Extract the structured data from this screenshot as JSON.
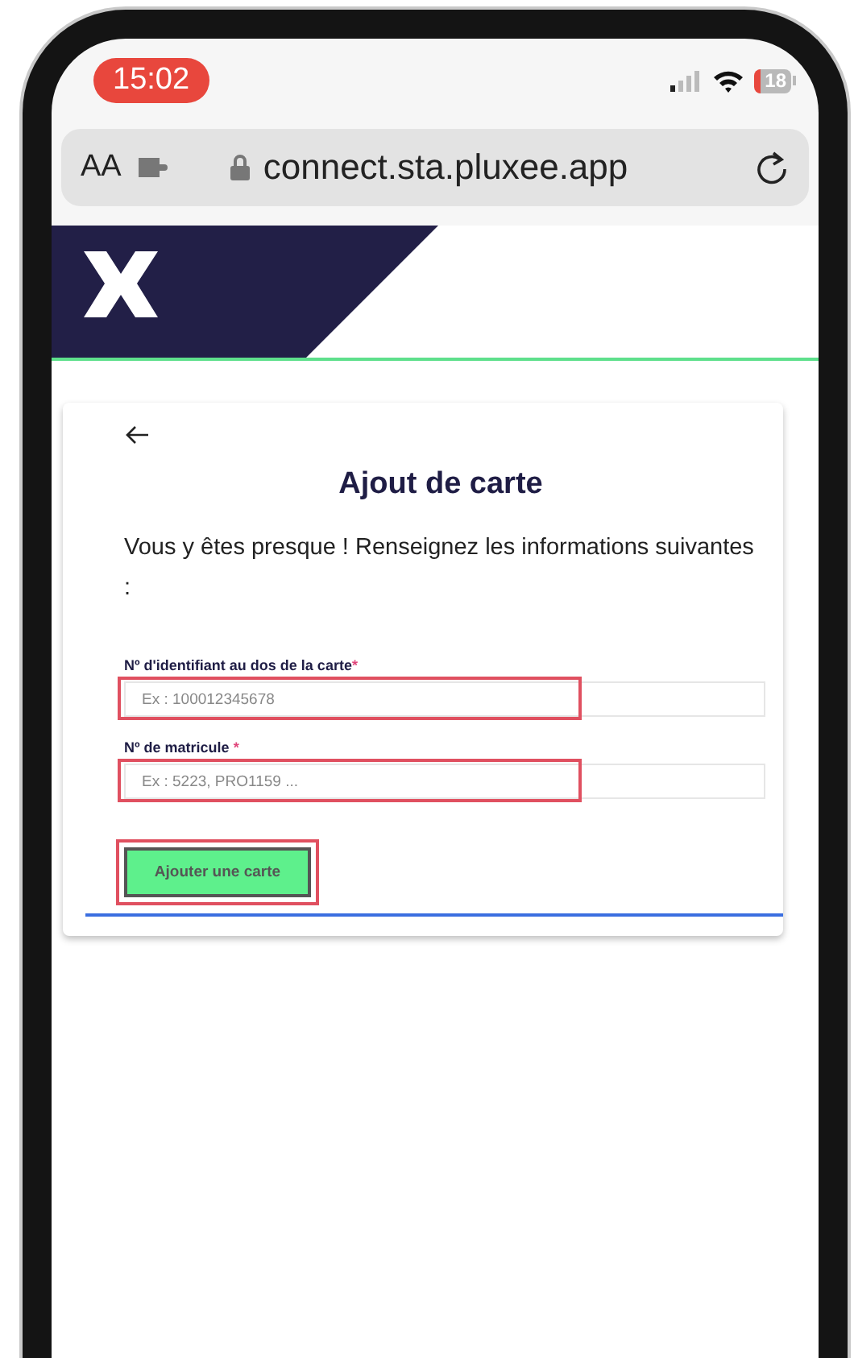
{
  "status_bar": {
    "time": "15:02",
    "battery": "18"
  },
  "browser": {
    "text_size": "AA",
    "url": "connect.sta.pluxee.app"
  },
  "form": {
    "title": "Ajout de carte",
    "intro": "Vous y êtes presque ! Renseignez les informations suivantes :",
    "fields": [
      {
        "label": "Nº d'identifiant au dos de la carte",
        "required_mark": "*",
        "placeholder": "Ex : 100012345678",
        "highlighted": true
      },
      {
        "label": "Nº de matricule ",
        "required_mark": "*",
        "placeholder": "Ex : 5223, PRO1159 ...",
        "highlighted": true
      }
    ],
    "button": {
      "label": "Ajouter une carte",
      "highlighted": true
    }
  }
}
